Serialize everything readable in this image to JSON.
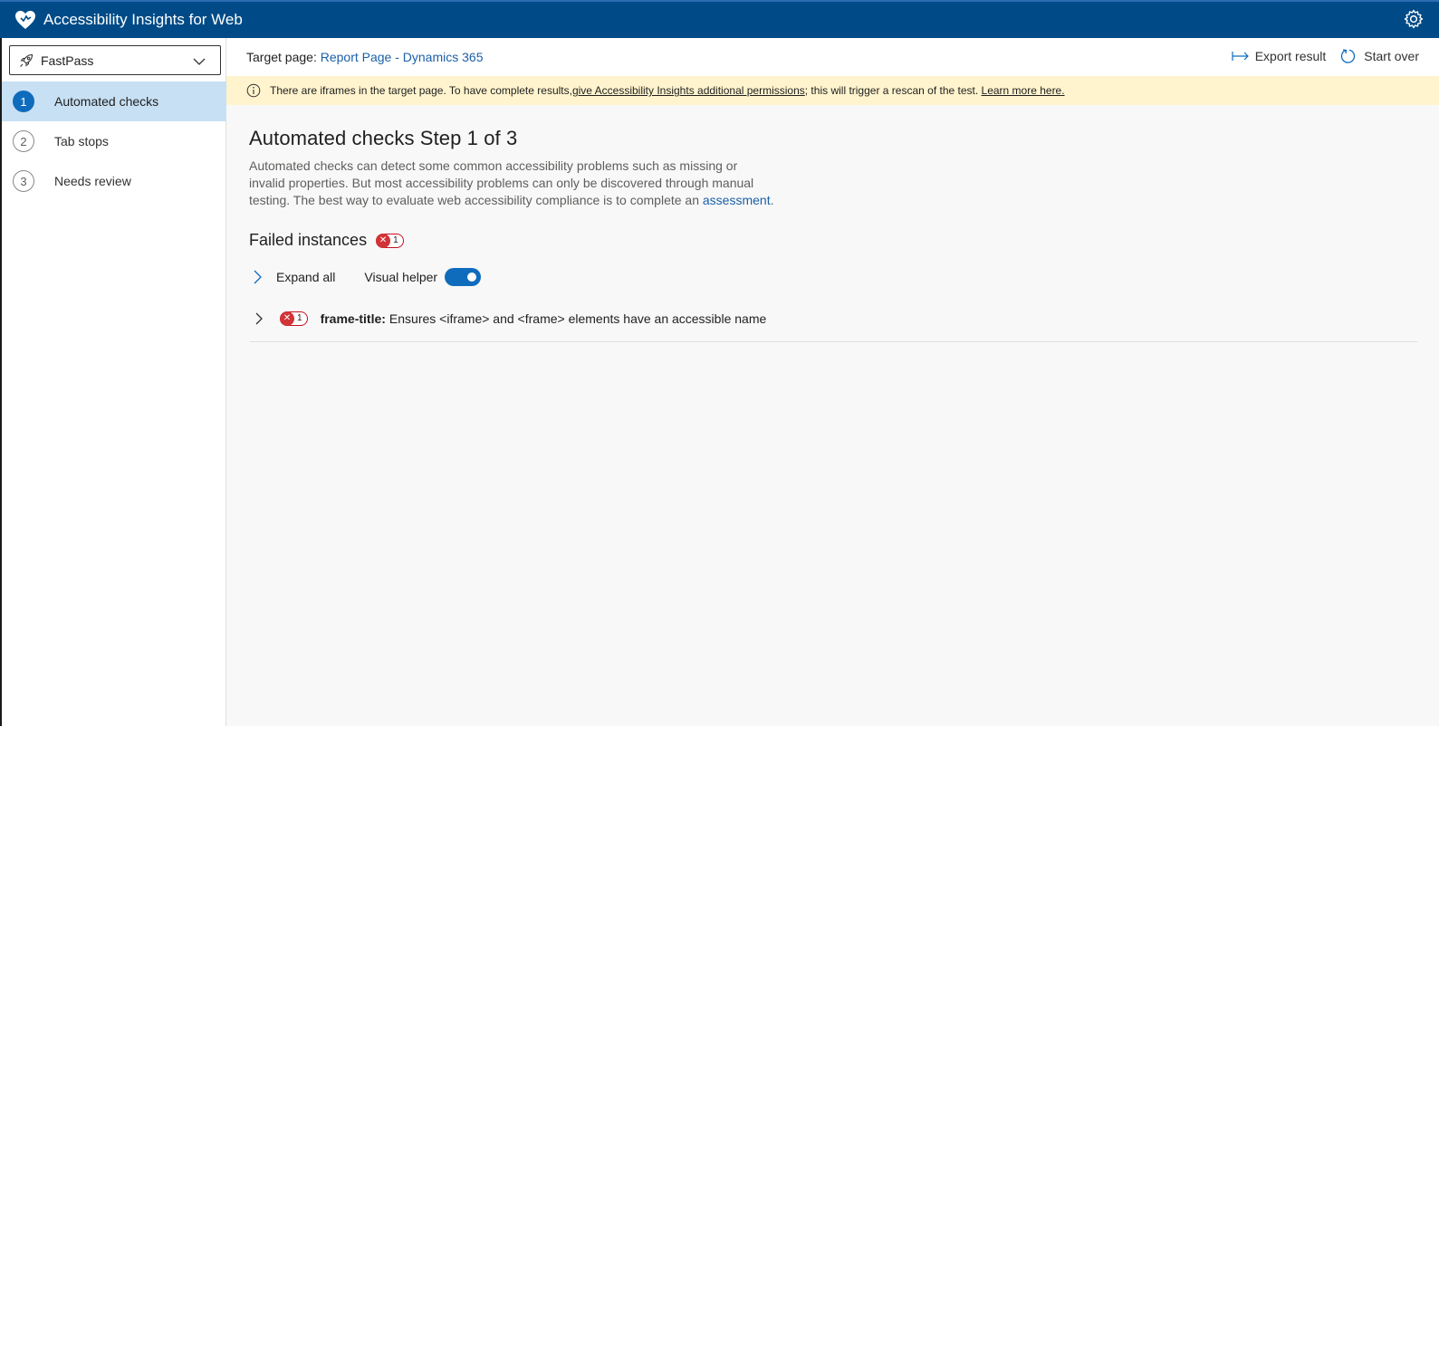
{
  "header": {
    "title": "Accessibility Insights for Web",
    "logo_icon": "heart-logo-icon",
    "settings_icon": "gear-icon"
  },
  "nav": {
    "mode": {
      "label": "FastPass",
      "icon": "rocket-icon"
    },
    "items": [
      {
        "number": "1",
        "label": "Automated checks",
        "active": true
      },
      {
        "number": "2",
        "label": "Tab stops",
        "active": false
      },
      {
        "number": "3",
        "label": "Needs review",
        "active": false
      }
    ]
  },
  "commandbar": {
    "target_label": "Target page:",
    "target_link": "Report Page - Dynamics 365",
    "export_label": "Export result",
    "start_over_label": "Start over"
  },
  "notice": {
    "text_before": "There are iframes in the target page. To have complete results, ",
    "link_permissions": "give Accessibility Insights additional permissions",
    "text_after": "; this will trigger a rescan of the test. ",
    "link_learn": "Learn more here."
  },
  "content": {
    "heading": "Automated checks Step 1 of 3",
    "description_before": "Automated checks can detect some common accessibility problems such as missing or invalid properties. But most accessibility problems can only be discovered through manual testing. The best way to evaluate web accessibility compliance is to complete an ",
    "description_link": "assessment",
    "description_after": ".",
    "failed_heading": "Failed instances",
    "failed_count": "1",
    "expand_all_label": "Expand all",
    "visual_helper_label": "Visual helper",
    "visual_helper_on": true,
    "rules": [
      {
        "id": "frame-title:",
        "count": "1",
        "description": "Ensures <iframe> and <frame> elements have an accessible name"
      }
    ]
  },
  "colors": {
    "header_bg": "#004b87",
    "accent": "#0f6cbd",
    "active_nav_bg": "#c7e0f4",
    "notice_bg": "#fff4ce",
    "error": "#d13438"
  }
}
